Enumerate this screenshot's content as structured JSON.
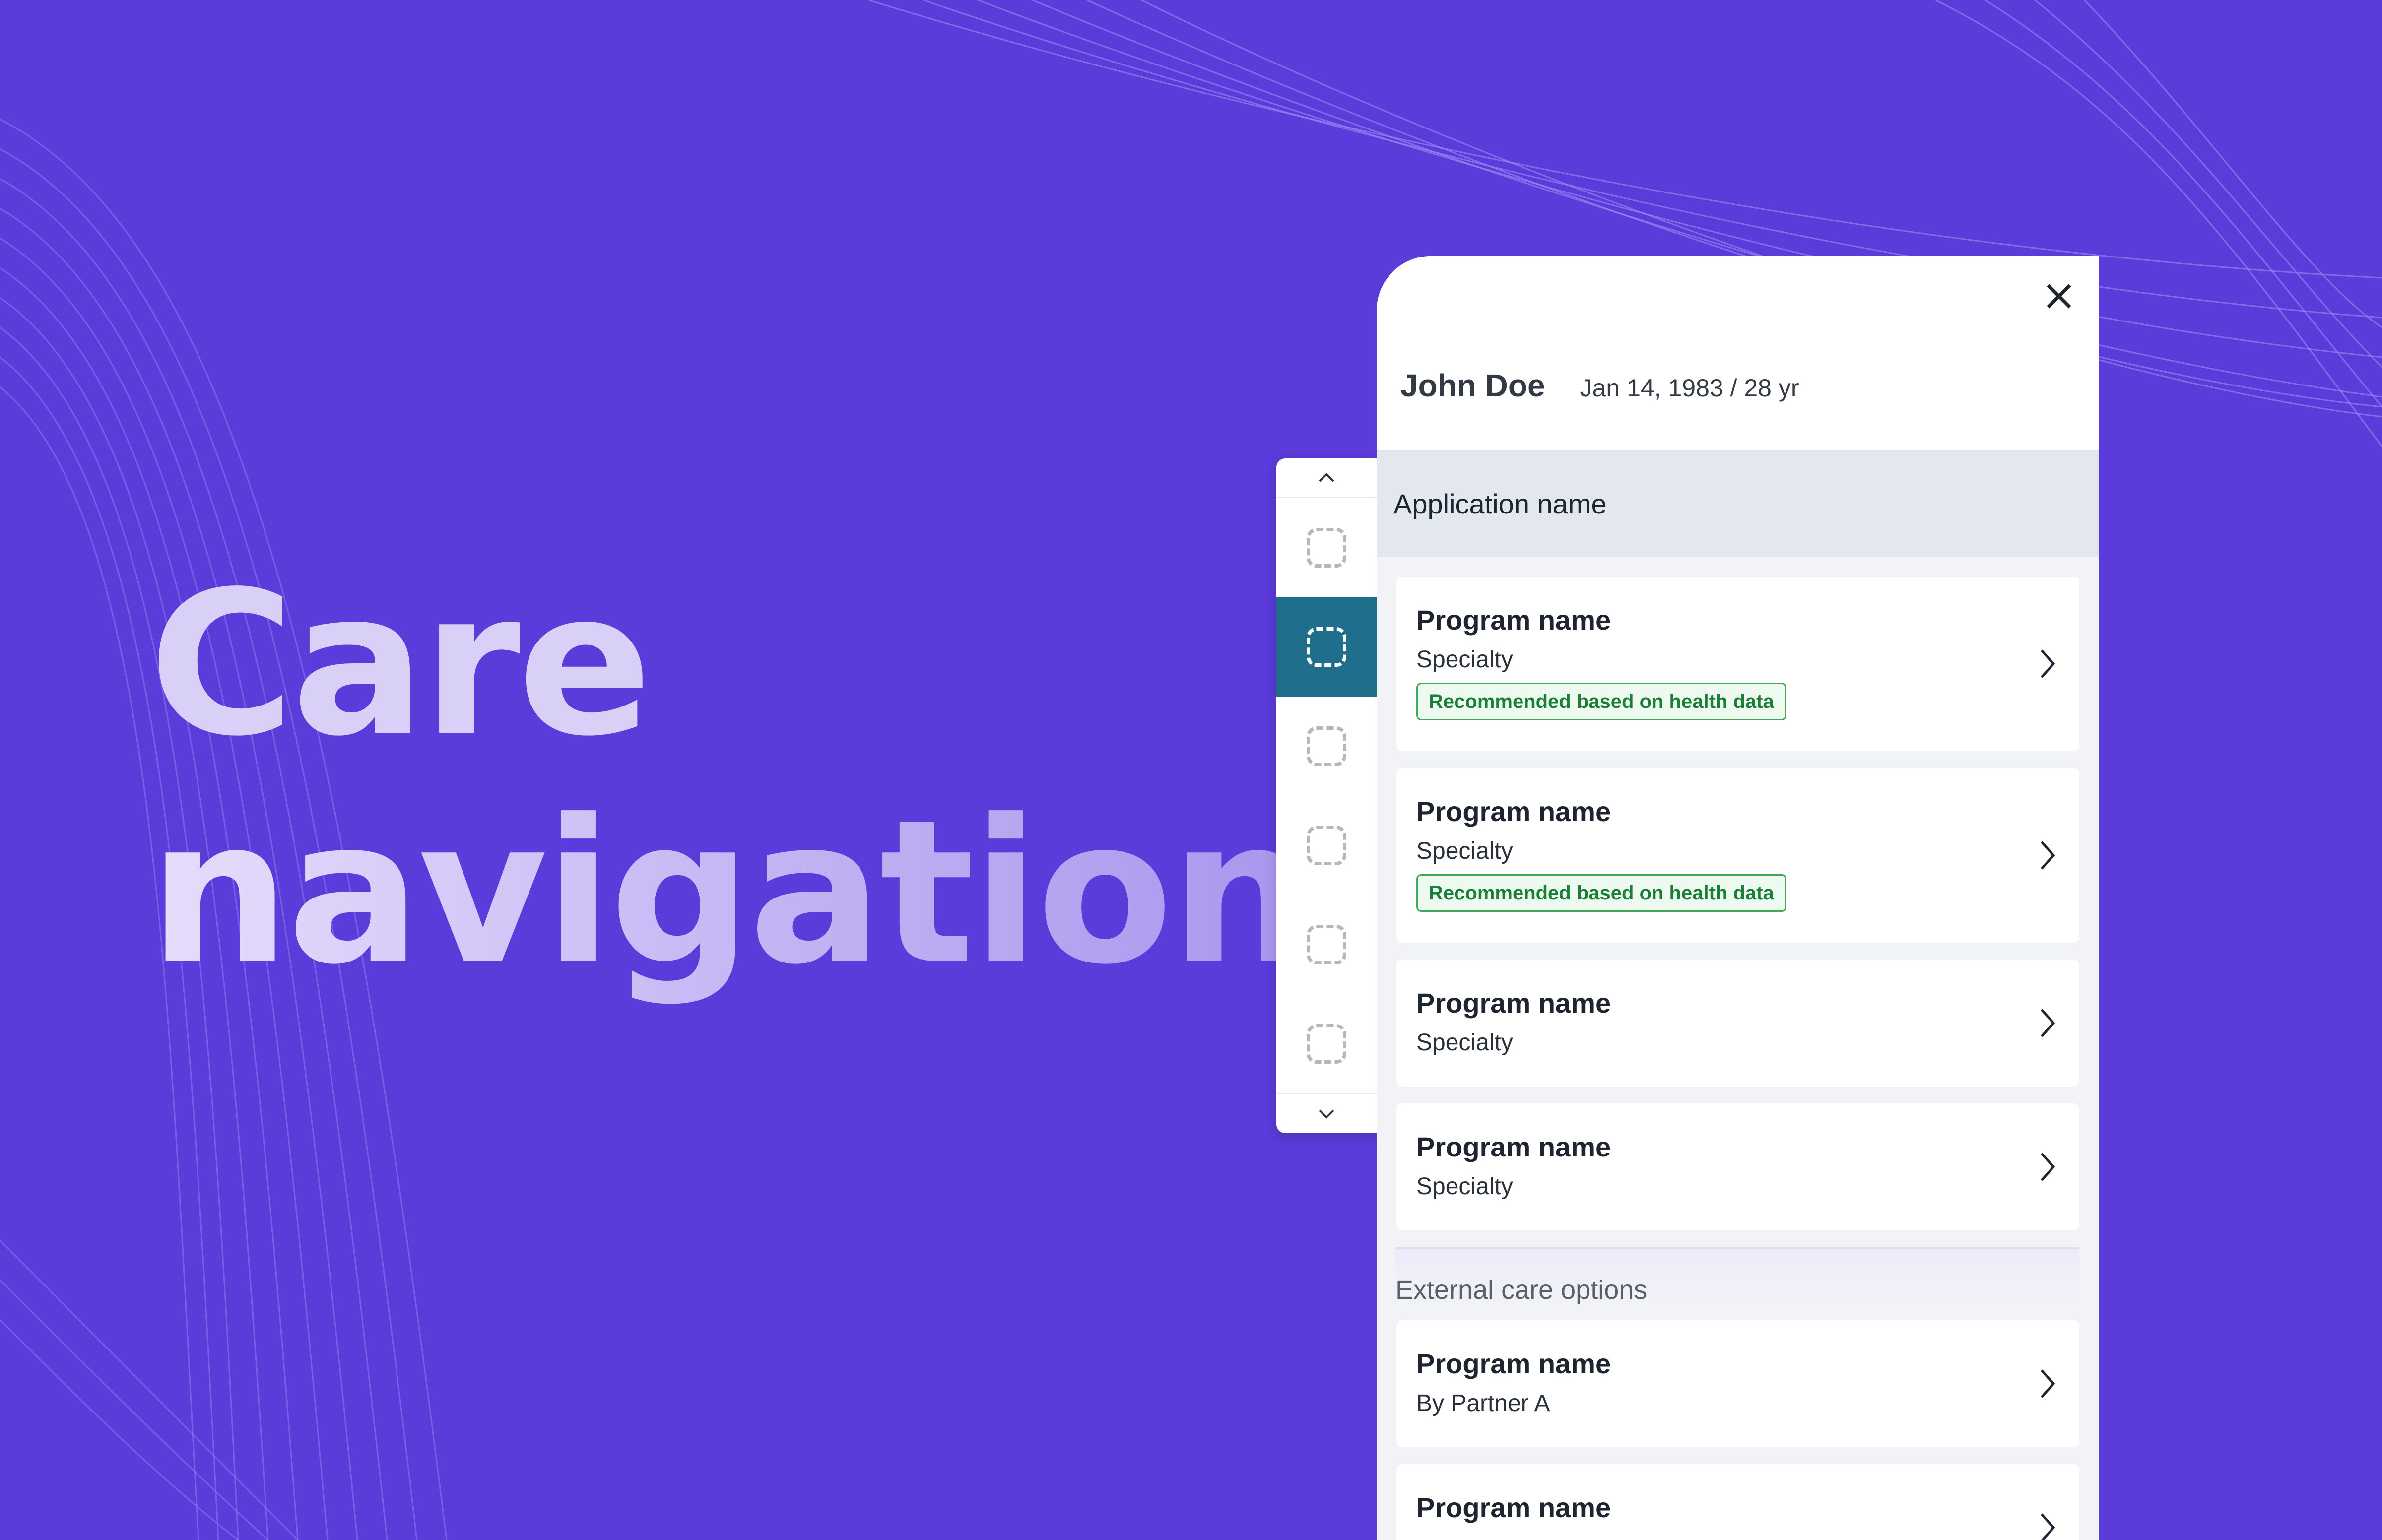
{
  "hero": {
    "line1": "Care",
    "line2": "navigation"
  },
  "icons": {
    "close": "close-icon",
    "rail_up": "chevron-up-icon",
    "rail_down": "chevron-down-icon",
    "chevron": "chevron-right-icon",
    "placeholder": "placeholder-icon"
  },
  "patient": {
    "name": "John Doe",
    "meta": "Jan 14, 1983 / 28 yr"
  },
  "app": {
    "name": "Application name"
  },
  "programs": [
    {
      "title": "Program name",
      "subtitle": "Specialty",
      "badge": "Recommended based on health data"
    },
    {
      "title": "Program name",
      "subtitle": "Specialty",
      "badge": "Recommended based on health data"
    },
    {
      "title": "Program name",
      "subtitle": "Specialty"
    },
    {
      "title": "Program name",
      "subtitle": "Specialty"
    }
  ],
  "external": {
    "label": "External care options",
    "items": [
      {
        "title": "Program name",
        "subtitle": "By Partner A"
      },
      {
        "title": "Program name"
      }
    ]
  },
  "colors": {
    "background": "#5b3bd9",
    "rail_active": "#1e6e8c",
    "badge_green": "#1a7f37"
  }
}
